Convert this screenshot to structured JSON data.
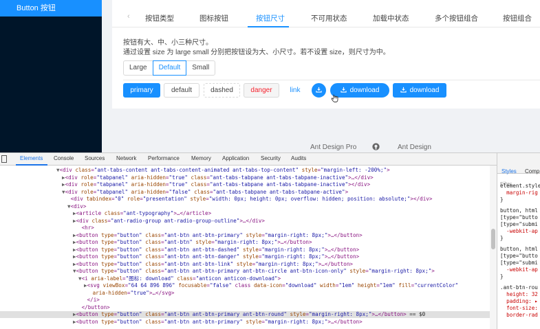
{
  "sidebar": {
    "active_item": "Button 按钮"
  },
  "tabs": {
    "items": [
      "按钮类型",
      "图标按钮",
      "按钮尺寸",
      "不可用状态",
      "加载中状态",
      "多个按钮组合",
      "按钮组合"
    ],
    "active_index": 2
  },
  "description": {
    "line1": "按钮有大、中、小三种尺寸。",
    "line2": "通过设置 size 为 large small 分别把按钮设为大、小尺寸。若不设置 size，则尺寸为中。"
  },
  "size_radio": {
    "options": [
      "Large",
      "Default",
      "Small"
    ],
    "selected": "Default"
  },
  "buttons": {
    "primary": "primary",
    "default": "default",
    "dashed": "dashed",
    "danger": "danger",
    "link": "link",
    "download": "download",
    "download2": "download"
  },
  "footer": {
    "left": "Ant Design Pro",
    "right": "Ant Design"
  },
  "devtools": {
    "tabs": [
      "Elements",
      "Console",
      "Sources",
      "Network",
      "Performance",
      "Memory",
      "Application",
      "Security",
      "Audits"
    ],
    "active_tab": "Elements",
    "selected_suffix": "== $0",
    "styles_tabs": [
      "Styles",
      "Comp"
    ],
    "filter_placeholder": "Filter",
    "styles_lines": [
      "element.style",
      "  margin-rig",
      "}",
      "button, html",
      "[type=\"butto",
      "[type=\"submi",
      "  -webkit-ap",
      "}",
      "button, html",
      "[type=\"butto",
      "[type=\"submi",
      "  -webkit-ap",
      "}",
      ".ant-btn-rou",
      "  height: 32",
      "  padding: ▸",
      "  font-size:",
      "  border-rad",
      "}"
    ]
  },
  "colors": {
    "primary": "#1890ff",
    "danger": "#f5222d",
    "sider": "#001529"
  }
}
